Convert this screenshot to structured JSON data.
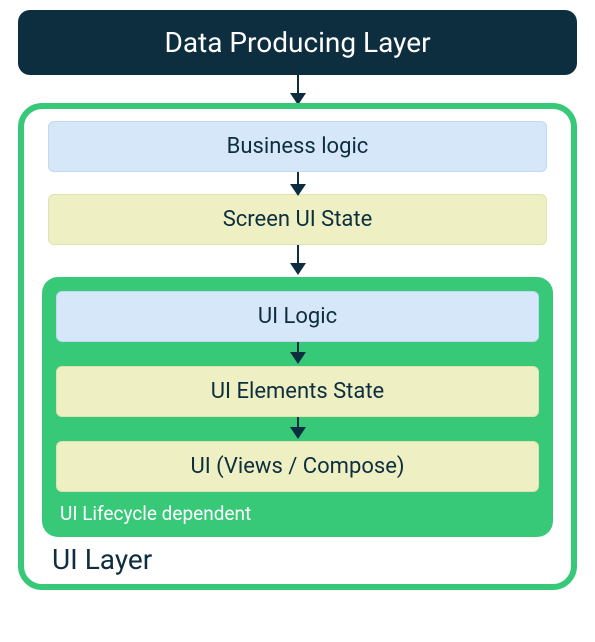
{
  "diagram": {
    "top_layer": "Data Producing Layer",
    "ui_layer_label": "UI Layer",
    "lifecycle_label": "UI Lifecycle dependent",
    "boxes": {
      "business_logic": "Business logic",
      "screen_ui_state": "Screen UI State",
      "ui_logic": "UI Logic",
      "ui_elements_state": "UI Elements State",
      "ui_views_compose": "UI (Views / Compose)"
    }
  },
  "colors": {
    "dark_navy": "#0d2e3e",
    "green": "#37c978",
    "light_blue": "#d6e7f9",
    "light_yellow": "#eef0c4"
  }
}
